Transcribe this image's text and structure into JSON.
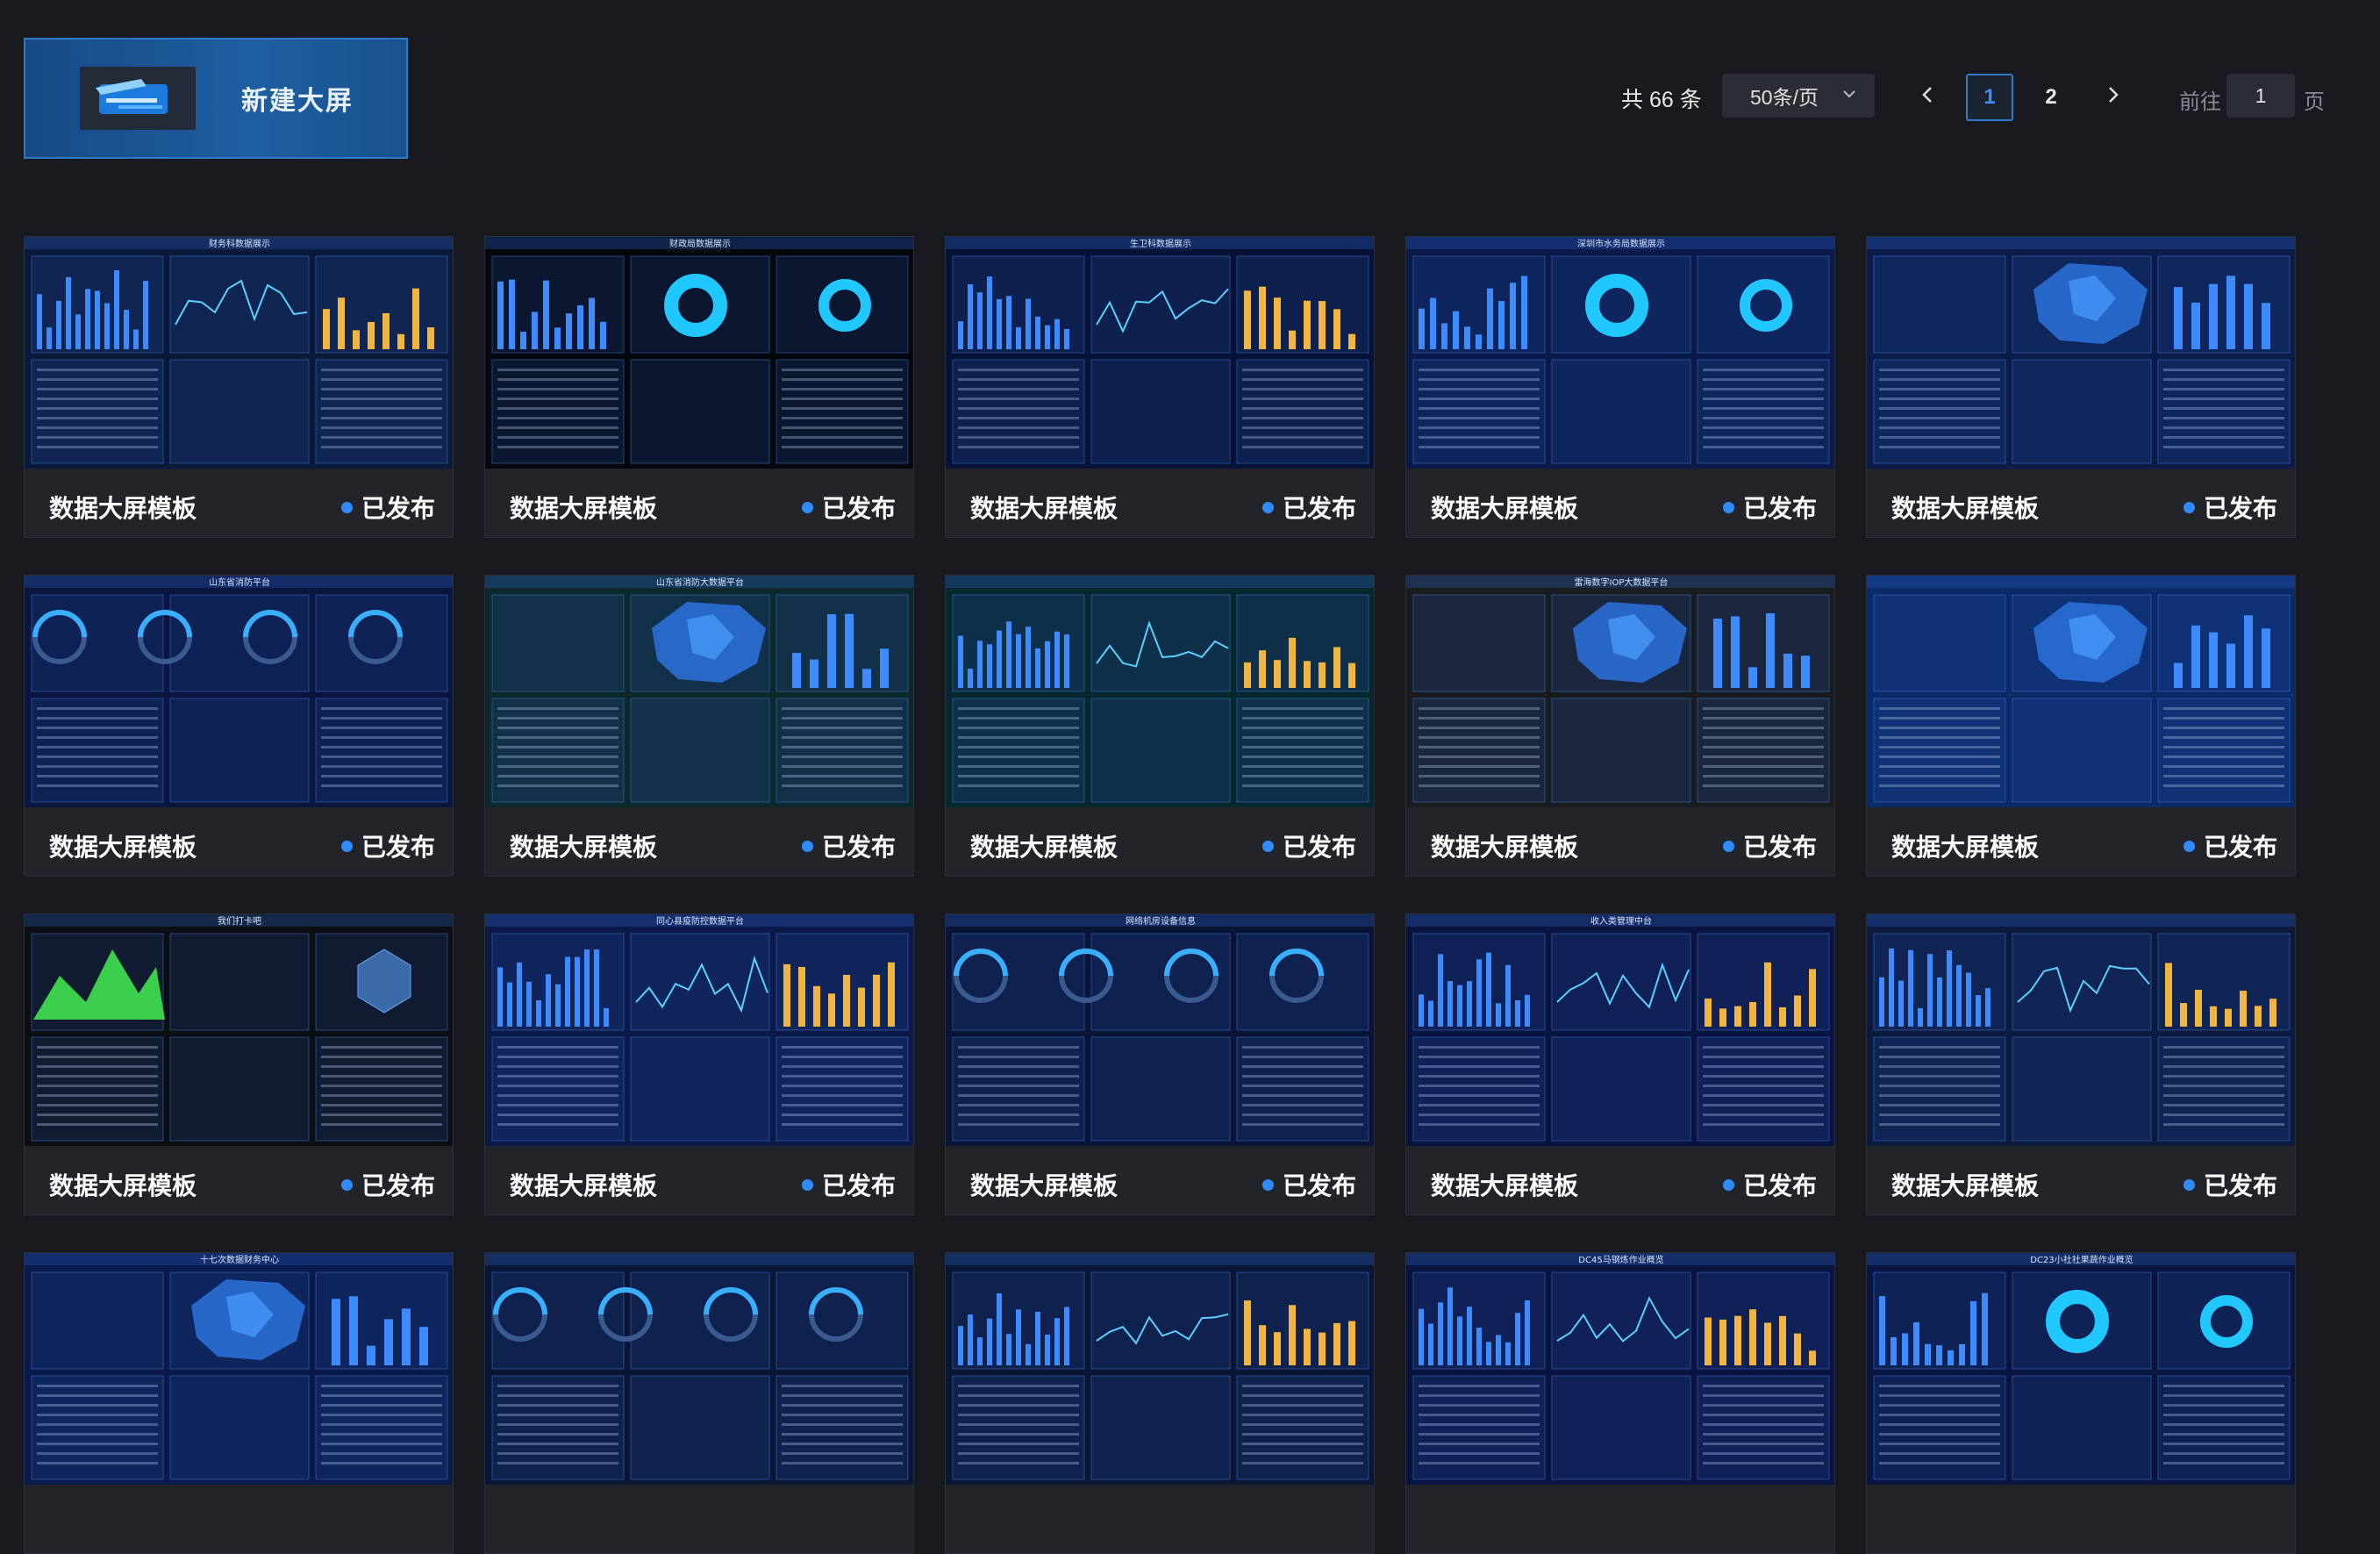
{
  "new_button": {
    "label": "新建大屏"
  },
  "pagination": {
    "total_text": "共 66 条",
    "page_size": "50条/页",
    "pages": [
      "1",
      "2"
    ],
    "current_page": "1",
    "goto_label": "前往",
    "goto_value": "1",
    "page_unit": "页"
  },
  "colors": {
    "accent": "#2f79c9",
    "status_dot": "#2f8bff",
    "background": "#181a1f"
  },
  "cards": [
    {
      "title": "数据大屏模板",
      "status": "已发布",
      "preview": {
        "bg": "#0b1a3a",
        "heading": "财务科数据展示",
        "style": "bars"
      }
    },
    {
      "title": "数据大屏模板",
      "status": "已发布",
      "preview": {
        "bg": "#05070f",
        "heading": "财政局数据展示",
        "style": "donuts"
      }
    },
    {
      "title": "数据大屏模板",
      "status": "已发布",
      "preview": {
        "bg": "#071336",
        "heading": "生卫科数据展示",
        "style": "bars"
      }
    },
    {
      "title": "数据大屏模板",
      "status": "已发布",
      "preview": {
        "bg": "#0a1a4a",
        "heading": "深圳市水务局数据展示",
        "style": "pie"
      }
    },
    {
      "title": "数据大屏模板",
      "status": "已发布",
      "preview": {
        "bg": "#0b1c4a",
        "heading": "",
        "style": "map"
      }
    },
    {
      "title": "数据大屏模板",
      "status": "已发布",
      "preview": {
        "bg": "#0a1640",
        "heading": "山东省消防平台",
        "style": "gauges"
      }
    },
    {
      "title": "数据大屏模板",
      "status": "已发布",
      "preview": {
        "bg": "#0c2a2e",
        "heading": "山东省消防大数据平台",
        "style": "map"
      }
    },
    {
      "title": "数据大屏模板",
      "status": "已发布",
      "preview": {
        "bg": "#082830",
        "heading": "",
        "style": "bars"
      }
    },
    {
      "title": "数据大屏模板",
      "status": "已发布",
      "preview": {
        "bg": "#1a1c20",
        "heading": "雷海数字IOP大数据平台",
        "style": "map"
      }
    },
    {
      "title": "数据大屏模板",
      "status": "已发布",
      "preview": {
        "bg": "#0a2a6a",
        "heading": "",
        "style": "map"
      }
    },
    {
      "title": "数据大屏模板",
      "status": "已发布",
      "preview": {
        "bg": "#0c0e12",
        "heading": "我们打卡吧",
        "style": "area"
      }
    },
    {
      "title": "数据大屏模板",
      "status": "已发布",
      "preview": {
        "bg": "#0c1a4a",
        "heading": "同心县疫防控数据平台",
        "style": "table"
      }
    },
    {
      "title": "数据大屏模板",
      "status": "已发布",
      "preview": {
        "bg": "#0a1436",
        "heading": "网络机房设备信息",
        "style": "gauges"
      }
    },
    {
      "title": "数据大屏模板",
      "status": "已发布",
      "preview": {
        "bg": "#0a1440",
        "heading": "收入类管理中台",
        "style": "table"
      }
    },
    {
      "title": "数据大屏模板",
      "status": "已发布",
      "preview": {
        "bg": "#0c1a3e",
        "heading": "",
        "style": "bars"
      }
    },
    {
      "title": "",
      "status": "",
      "preview": {
        "bg": "#0a1a4a",
        "heading": "十七次数据财务中心",
        "style": "map"
      }
    },
    {
      "title": "",
      "status": "",
      "preview": {
        "bg": "#0a1636",
        "heading": "",
        "style": "gauges"
      }
    },
    {
      "title": "",
      "status": "",
      "preview": {
        "bg": "#0a1636",
        "heading": "",
        "style": "table"
      }
    },
    {
      "title": "",
      "status": "",
      "preview": {
        "bg": "#0a1440",
        "heading": "DC45马钢炼作业概览",
        "style": "table"
      }
    },
    {
      "title": "",
      "status": "",
      "preview": {
        "bg": "#0a1640",
        "heading": "DC23小社社果蔬作业概览",
        "style": "pie"
      }
    }
  ]
}
